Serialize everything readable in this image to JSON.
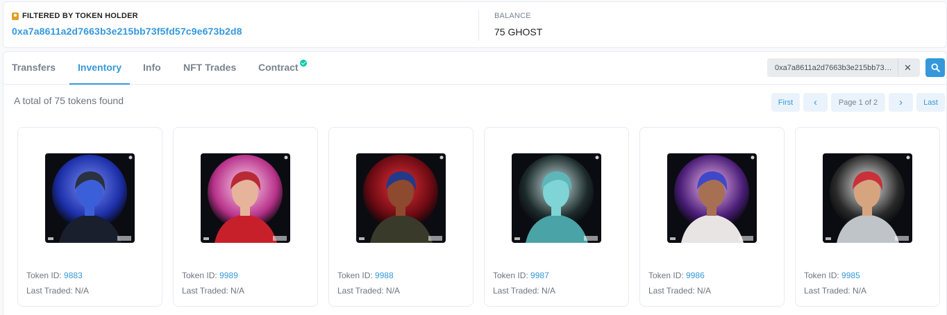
{
  "holder": {
    "label": "FILTERED BY TOKEN HOLDER",
    "address": "0xa7a8611a2d7663b3e215bb73f5fd57c9e673b2d8",
    "balance_label": "BALANCE",
    "balance_value": "75 GHOST"
  },
  "tabs": [
    {
      "label": "Transfers",
      "active": false
    },
    {
      "label": "Inventory",
      "active": true
    },
    {
      "label": "Info",
      "active": false
    },
    {
      "label": "NFT Trades",
      "active": false
    },
    {
      "label": "Contract",
      "active": false,
      "verified": true
    }
  ],
  "search": {
    "value": "0xa7a8611a2d7663b3e215bb73f5..."
  },
  "summary": {
    "total_text": "A total of 75 tokens found"
  },
  "pagination": {
    "first": "First",
    "prev": "‹",
    "page": "Page 1 of 2",
    "next": "›",
    "last": "Last"
  },
  "tokens": [
    {
      "id_label": "Token ID:",
      "id": "9883",
      "traded": "Last Traded: N/A",
      "bg": "#1c2fa8",
      "glow": "#7a8cf5",
      "skin": "#3b5fd8",
      "hair": "#2a3140",
      "outfit": "#1a1f2e",
      "hero": "face-blue"
    },
    {
      "id_label": "Token ID:",
      "id": "9989",
      "traded": "Last Traded: N/A",
      "bg": "#b8328a",
      "glow": "#ffd7ef",
      "skin": "#e6b49b",
      "hair": "#b82a36",
      "outfit": "#c8202a",
      "hero": "face-red"
    },
    {
      "id_label": "Token ID:",
      "id": "9988",
      "traded": "Last Traded: N/A",
      "bg": "#6a0a12",
      "glow": "#e8303a",
      "skin": "#8e4a2e",
      "hair": "#233a8a",
      "outfit": "#3a3a2a",
      "hero": "face-dark"
    },
    {
      "id_label": "Token ID:",
      "id": "9987",
      "traded": "Last Traded: N/A",
      "bg": "#1d2b2c",
      "glow": "#cfe7e8",
      "skin": "#7fd4d6",
      "hair": "#5fb6b8",
      "outfit": "#4aa3a6",
      "hero": "face-teal"
    },
    {
      "id_label": "Token ID:",
      "id": "9986",
      "traded": "Last Traded: N/A",
      "bg": "#4b1e78",
      "glow": "#f3b9f0",
      "skin": "#a87052",
      "hair": "#3e48c8",
      "outfit": "#e8e4e4",
      "hero": "face-purple"
    },
    {
      "id_label": "Token ID:",
      "id": "9985",
      "traded": "Last Traded: N/A",
      "bg": "#2a2a2a",
      "glow": "#f2f2f2",
      "skin": "#d6a57f",
      "hair": "#c9303a",
      "outfit": "#bfc4c8",
      "hero": "face-astro"
    }
  ]
}
